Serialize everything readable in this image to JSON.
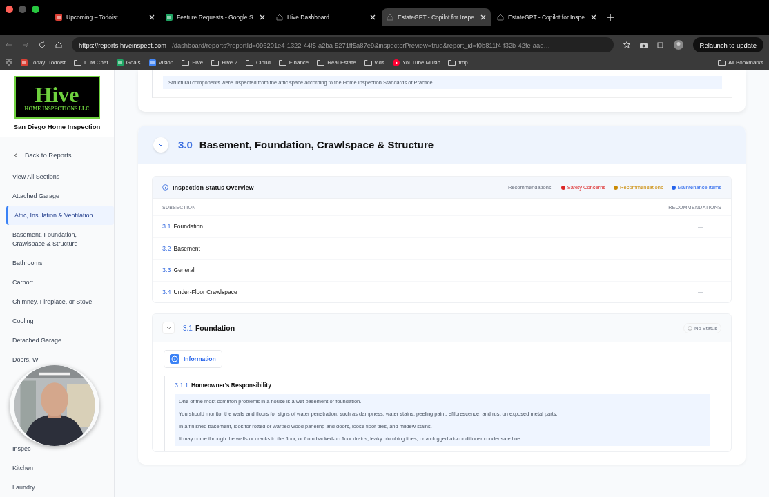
{
  "browser": {
    "tabs": [
      {
        "title": "Upcoming – Todoist",
        "kind": "todoist",
        "selected": false
      },
      {
        "title": "Feature Requests - Google S",
        "kind": "sheets",
        "selected": false
      },
      {
        "title": "Hive Dashboard",
        "kind": "hive",
        "selected": false
      },
      {
        "title": "EstateGPT - Copilot for Inspe",
        "kind": "hive",
        "selected": true
      },
      {
        "title": "EstateGPT - Copilot for Inspe",
        "kind": "hive",
        "selected": false
      }
    ],
    "url_host": "https://reports.hiveinspect.com",
    "url_path": "/dashboard/reports?reportId=096201e4-1322-44f5-a2ba-5271ff5a87e9&inspectorPreview=true&report_id=f0b811f4-f32b-42fe-aae…",
    "relaunch": "Relaunch to update",
    "bookmarks": [
      {
        "label": "Today: Todoist",
        "kind": "todoist"
      },
      {
        "label": "LLM Chat",
        "kind": "folder"
      },
      {
        "label": "Goals",
        "kind": "sheets"
      },
      {
        "label": "Vision",
        "kind": "docs"
      },
      {
        "label": "Hive",
        "kind": "folder"
      },
      {
        "label": "Hive 2",
        "kind": "folder"
      },
      {
        "label": "Cloud",
        "kind": "folder"
      },
      {
        "label": "Finance",
        "kind": "folder"
      },
      {
        "label": "Real Estate",
        "kind": "folder"
      },
      {
        "label": "vids",
        "kind": "folder"
      },
      {
        "label": "YouTube Music",
        "kind": "music"
      },
      {
        "label": "tmp",
        "kind": "folder"
      }
    ],
    "all_bookmarks": "All Bookmarks"
  },
  "sidebar": {
    "logo_word": "Hive",
    "logo_sub": "HOME INSPECTIONS LLC",
    "company": "San Diego Home Inspection",
    "back": "Back to Reports",
    "items": [
      {
        "kind": "link",
        "label": "View All Sections",
        "selected": false
      },
      {
        "kind": "link",
        "label": "Attached Garage",
        "selected": false
      },
      {
        "kind": "link",
        "label": "Attic, Insulation & Ventilation",
        "selected": true
      },
      {
        "kind": "link",
        "label": "Basement, Foundation, Crawlspace & Structure",
        "selected": false
      },
      {
        "kind": "link",
        "label": "Bathrooms",
        "selected": false
      },
      {
        "kind": "link",
        "label": "Carport",
        "selected": false
      },
      {
        "kind": "link",
        "label": "Chimney, Fireplace, or Stove",
        "selected": false
      },
      {
        "kind": "link",
        "label": "Cooling",
        "selected": false
      },
      {
        "kind": "link",
        "label": "Detached Garage",
        "selected": false
      },
      {
        "kind": "link",
        "label": "Doors, W",
        "selected": false
      },
      {
        "kind": "video"
      },
      {
        "kind": "link",
        "label": "Inspec",
        "selected": false
      },
      {
        "kind": "link",
        "label": "Kitchen",
        "selected": false
      },
      {
        "kind": "link",
        "label": "Laundry",
        "selected": false
      }
    ]
  },
  "previous_note": "Structural components were inspected from the attic space according to the Home Inspection Standards of Practice.",
  "section": {
    "number": "3.0",
    "title": "Basement, Foundation, Crawlspace & Structure",
    "expanded": true,
    "overview": {
      "title": "Inspection Status Overview",
      "legend_label": "Recommendations:",
      "legend": [
        {
          "label": "Safety Concerns",
          "color": "#dc2626"
        },
        {
          "label": "Recommendations",
          "color": "#ca8a04"
        },
        {
          "label": "Maintenance Items",
          "color": "#2563eb"
        }
      ],
      "columns": [
        "SUBSECTION",
        "RECOMMENDATIONS"
      ],
      "rows": [
        {
          "number": "3.1",
          "name": "Foundation",
          "value": "—"
        },
        {
          "number": "3.2",
          "name": "Basement",
          "value": "—"
        },
        {
          "number": "3.3",
          "name": "General",
          "value": "—"
        },
        {
          "number": "3.4",
          "name": "Under-Floor Crawlspace",
          "value": "—"
        }
      ]
    },
    "subsection": {
      "number": "3.1",
      "title": "Foundation",
      "status": "No Status",
      "tab": "Information",
      "item": {
        "number": "3.1.1",
        "title": "Homeowner's Responsibility",
        "paragraphs": [
          "One of the most common problems in a house is a wet basement or foundation.",
          "You should monitor the walls and floors for signs of water penetration, such as dampness, water stains, peeling paint, efflorescence, and rust on exposed metal parts.",
          "In a finished basement, look for rotted or warped wood paneling and doors, loose floor tiles, and mildew stains.",
          "It may come through the walls or cracks in the floor, or from backed-up floor drains, leaky plumbing lines, or a clogged air-conditioner condensate line."
        ]
      }
    }
  }
}
